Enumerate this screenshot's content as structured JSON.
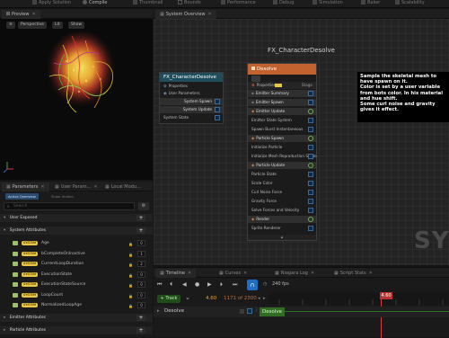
{
  "toolbar": {
    "items": [
      "Apply Solution",
      "Compile",
      "Thumbnail",
      "Bounds",
      "Performance",
      "Debug",
      "Simulation",
      "Baker",
      "Scalability"
    ]
  },
  "preview": {
    "tab_label": "Preview",
    "perspective_label": "Perspective",
    "lit_label": "Lit",
    "show_label": "Show"
  },
  "params": {
    "tabs": [
      "Parameters",
      "User Param...",
      "Local Modu..."
    ],
    "subtabs": [
      "Active Overview",
      "Show Hidden"
    ],
    "search_placeholder": "Search",
    "sections": {
      "user_exposed": "User Exposed",
      "system_attributes": "System Attributes",
      "emitter_attributes": "Emitter Attributes",
      "particle_attributes": "Particle Attributes"
    },
    "type_label": "SYSTEM",
    "rows": [
      {
        "name": "Age",
        "value": "0"
      },
      {
        "name": "bCompleteOnInactive",
        "value": "1"
      },
      {
        "name": "CurrentLoopDuration",
        "value": "2"
      },
      {
        "name": "ExecutionState",
        "value": "0"
      },
      {
        "name": "ExecutionStateSource",
        "value": "0"
      },
      {
        "name": "LoopCount",
        "value": "0"
      },
      {
        "name": "NormalizedLoopAge",
        "value": "0"
      }
    ],
    "colors": {
      "section_bg": "#222222",
      "system_pill": "#e8c64a"
    }
  },
  "graph": {
    "tab_label": "System Overview",
    "title": "FX_CharacterDesolve",
    "watermark": "SYS",
    "system_node": {
      "title": "FX_CharacterDesolve",
      "rows": [
        "Properties",
        "User Parameters",
        "System Spawn",
        "System Update",
        "System State"
      ]
    },
    "emitter_node": {
      "title": "Desolve",
      "header_row": "Properties",
      "header_badge": "Stage",
      "rows": [
        {
          "label": "Emitter Summary",
          "kind": "section"
        },
        {
          "label": "Emitter Spawn",
          "kind": "section"
        },
        {
          "label": "Emitter Update",
          "kind": "stage"
        },
        {
          "label": "Emitter State  System",
          "kind": "row"
        },
        {
          "label": "Spawn Burst Instantaneous",
          "kind": "row"
        },
        {
          "label": "Particle Spawn",
          "kind": "stage"
        },
        {
          "label": "Initialize Particle",
          "kind": "row"
        },
        {
          "label": "Initialize Mesh Reproduction Sprite",
          "kind": "row"
        },
        {
          "label": "Particle Update",
          "kind": "stage"
        },
        {
          "label": "Particle State",
          "kind": "row"
        },
        {
          "label": "Scale Color",
          "kind": "row"
        },
        {
          "label": "Curl Noise Force",
          "kind": "row"
        },
        {
          "label": "Gravity Force",
          "kind": "row"
        },
        {
          "label": "Solve Forces and Velocity",
          "kind": "row"
        },
        {
          "label": "Render",
          "kind": "stage"
        },
        {
          "label": "Sprite Renderer",
          "kind": "row"
        }
      ]
    },
    "note": "Sample the skeletal mesh to have spawn on it.\nColor is set by a user variable from bots color. In his material and hue shift.\nSome curl noise and gravity gives it effect."
  },
  "timeline": {
    "tabs": [
      "Timeline",
      "Curves",
      "Niagara Log",
      "Script Stats"
    ],
    "current_time": "4.60",
    "frame_info": "1171 of 2300",
    "fps_label": "240 fps",
    "add_track_label": "+ Track",
    "track_name": "Desolve",
    "track_chip": "Desolve",
    "playhead_label": "4.60",
    "colors": {
      "playhead": "#d43b3b",
      "track_chip": "#2e6d22"
    }
  }
}
